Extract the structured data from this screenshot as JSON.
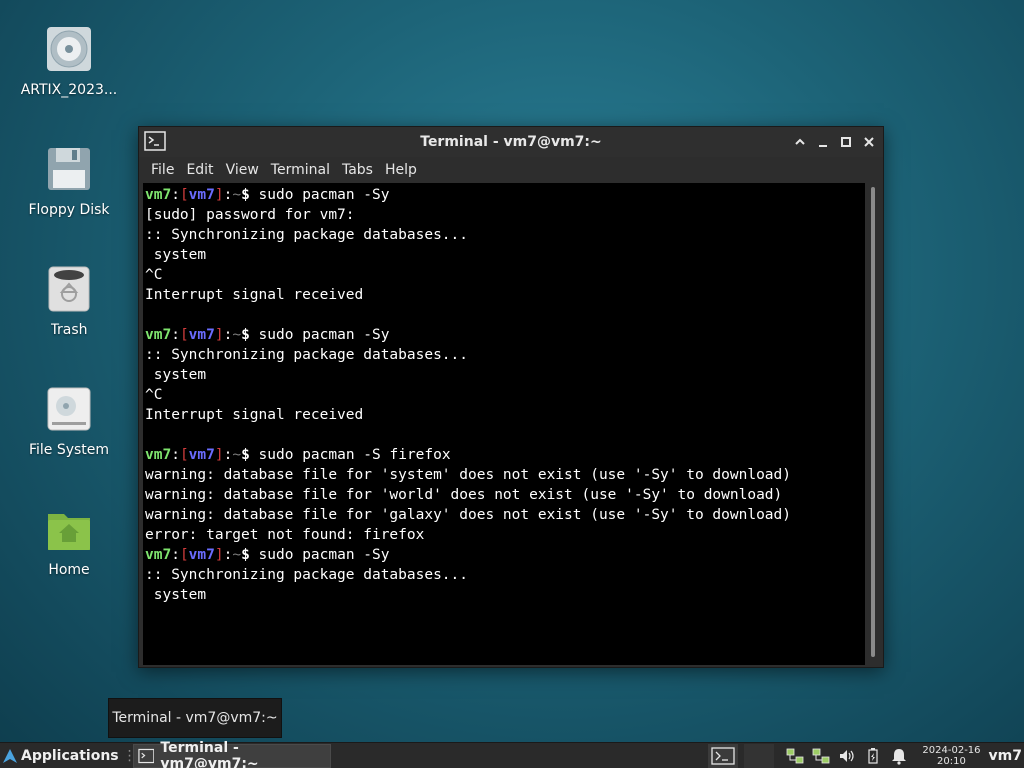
{
  "desktop": {
    "icons": [
      {
        "label": "ARTIX_2023..."
      },
      {
        "label": "Floppy Disk"
      },
      {
        "label": "Trash"
      },
      {
        "label": "File System"
      },
      {
        "label": "Home"
      }
    ]
  },
  "window": {
    "title": "Terminal - vm7@vm7:~",
    "menus": [
      "File",
      "Edit",
      "View",
      "Terminal",
      "Tabs",
      "Help"
    ]
  },
  "terminal": {
    "prompt": {
      "user": "vm7",
      "host": "vm7",
      "path": "~"
    },
    "lines": [
      {
        "prompt": true,
        "text": " sudo pacman -Sy"
      },
      {
        "prompt": false,
        "text": "[sudo] password for vm7:"
      },
      {
        "prompt": false,
        "text": ":: Synchronizing package databases..."
      },
      {
        "prompt": false,
        "text": " system"
      },
      {
        "prompt": false,
        "text": "^C"
      },
      {
        "prompt": false,
        "text": "Interrupt signal received"
      },
      {
        "prompt": false,
        "text": ""
      },
      {
        "prompt": true,
        "text": " sudo pacman -Sy"
      },
      {
        "prompt": false,
        "text": ":: Synchronizing package databases..."
      },
      {
        "prompt": false,
        "text": " system"
      },
      {
        "prompt": false,
        "text": "^C"
      },
      {
        "prompt": false,
        "text": "Interrupt signal received"
      },
      {
        "prompt": false,
        "text": ""
      },
      {
        "prompt": true,
        "text": " sudo pacman -S firefox"
      },
      {
        "prompt": false,
        "text": "warning: database file for 'system' does not exist (use '-Sy' to download)"
      },
      {
        "prompt": false,
        "text": "warning: database file for 'world' does not exist (use '-Sy' to download)"
      },
      {
        "prompt": false,
        "text": "warning: database file for 'galaxy' does not exist (use '-Sy' to download)"
      },
      {
        "prompt": false,
        "text": "error: target not found: firefox"
      },
      {
        "prompt": true,
        "text": " sudo pacman -Sy"
      },
      {
        "prompt": false,
        "text": ":: Synchronizing package databases..."
      },
      {
        "prompt": false,
        "text": " system"
      }
    ]
  },
  "tooltip": {
    "text": "Terminal - vm7@vm7:~"
  },
  "taskbar": {
    "applications_label": "Applications",
    "task_label": "Terminal - vm7@vm7:~",
    "clock_date": "2024-02-16",
    "clock_time": "20:10",
    "user_label": "vm7"
  },
  "colors": {
    "prompt_user": "#7ee36d",
    "prompt_host": "#6a6cff",
    "prompt_bracket": "#d23c3c",
    "terminal_bg": "#000000"
  }
}
